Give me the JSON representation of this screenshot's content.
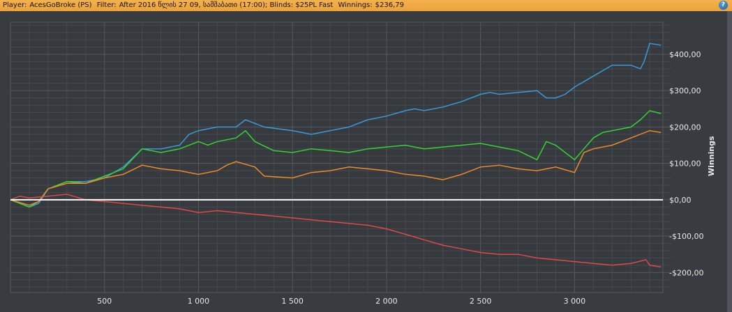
{
  "header": {
    "player_label": "Player:",
    "player": "AcesGoBroke (PS)",
    "filter_label": "Filter:",
    "filter": "After 2016 წლის 27 09, სამშაბათი (17:00); Blinds: $25PL Fast",
    "winnings_label": "Winnings:",
    "winnings": "$236,79",
    "help": "?"
  },
  "chart_data": {
    "type": "line",
    "title": "",
    "xlabel": "",
    "ylabel": "Winnings",
    "xlim": [
      0,
      3470
    ],
    "ylim": [
      -255,
      488
    ],
    "x_ticks": [
      500,
      1000,
      1500,
      2000,
      2500,
      3000
    ],
    "x_tick_labels": [
      "500",
      "1 000",
      "1 500",
      "2 000",
      "2 500",
      "3 000"
    ],
    "y_ticks": [
      400,
      300,
      200,
      100,
      0,
      -100,
      -200
    ],
    "y_tick_labels": [
      "$400,00",
      "$300,00",
      "$200,00",
      "$100,00",
      "$0,00",
      "-$100,00",
      "-$200,00"
    ],
    "grid": true,
    "series": [
      {
        "name": "blue",
        "color": "#3a9ad9",
        "points": [
          [
            0,
            0
          ],
          [
            100,
            -20
          ],
          [
            150,
            -10
          ],
          [
            200,
            30
          ],
          [
            300,
            50
          ],
          [
            400,
            50
          ],
          [
            500,
            60
          ],
          [
            600,
            90
          ],
          [
            700,
            140
          ],
          [
            800,
            140
          ],
          [
            900,
            150
          ],
          [
            950,
            180
          ],
          [
            1000,
            190
          ],
          [
            1100,
            200
          ],
          [
            1200,
            200
          ],
          [
            1250,
            220
          ],
          [
            1350,
            200
          ],
          [
            1500,
            190
          ],
          [
            1600,
            180
          ],
          [
            1700,
            190
          ],
          [
            1800,
            200
          ],
          [
            1900,
            220
          ],
          [
            2000,
            230
          ],
          [
            2100,
            245
          ],
          [
            2150,
            250
          ],
          [
            2200,
            245
          ],
          [
            2300,
            255
          ],
          [
            2400,
            270
          ],
          [
            2500,
            290
          ],
          [
            2550,
            295
          ],
          [
            2600,
            290
          ],
          [
            2700,
            295
          ],
          [
            2800,
            300
          ],
          [
            2850,
            280
          ],
          [
            2900,
            280
          ],
          [
            2950,
            290
          ],
          [
            3000,
            310
          ],
          [
            3100,
            340
          ],
          [
            3200,
            370
          ],
          [
            3300,
            370
          ],
          [
            3350,
            360
          ],
          [
            3370,
            380
          ],
          [
            3400,
            430
          ],
          [
            3460,
            425
          ]
        ]
      },
      {
        "name": "green",
        "color": "#33d433",
        "points": [
          [
            0,
            0
          ],
          [
            100,
            -20
          ],
          [
            150,
            -5
          ],
          [
            200,
            30
          ],
          [
            300,
            50
          ],
          [
            400,
            45
          ],
          [
            500,
            65
          ],
          [
            600,
            85
          ],
          [
            700,
            140
          ],
          [
            800,
            130
          ],
          [
            900,
            140
          ],
          [
            1000,
            160
          ],
          [
            1050,
            150
          ],
          [
            1100,
            160
          ],
          [
            1200,
            170
          ],
          [
            1250,
            190
          ],
          [
            1300,
            160
          ],
          [
            1400,
            135
          ],
          [
            1500,
            130
          ],
          [
            1600,
            140
          ],
          [
            1700,
            135
          ],
          [
            1800,
            130
          ],
          [
            1900,
            140
          ],
          [
            2000,
            145
          ],
          [
            2100,
            150
          ],
          [
            2200,
            140
          ],
          [
            2300,
            145
          ],
          [
            2400,
            150
          ],
          [
            2500,
            155
          ],
          [
            2600,
            145
          ],
          [
            2700,
            135
          ],
          [
            2800,
            110
          ],
          [
            2850,
            160
          ],
          [
            2900,
            150
          ],
          [
            3000,
            110
          ],
          [
            3050,
            140
          ],
          [
            3100,
            170
          ],
          [
            3150,
            185
          ],
          [
            3200,
            190
          ],
          [
            3300,
            200
          ],
          [
            3350,
            220
          ],
          [
            3400,
            245
          ],
          [
            3460,
            237
          ]
        ]
      },
      {
        "name": "orange",
        "color": "#ee8a2a",
        "points": [
          [
            0,
            0
          ],
          [
            100,
            -15
          ],
          [
            150,
            -5
          ],
          [
            200,
            30
          ],
          [
            300,
            45
          ],
          [
            400,
            45
          ],
          [
            500,
            60
          ],
          [
            600,
            70
          ],
          [
            700,
            95
          ],
          [
            800,
            85
          ],
          [
            900,
            80
          ],
          [
            1000,
            70
          ],
          [
            1100,
            80
          ],
          [
            1150,
            95
          ],
          [
            1200,
            105
          ],
          [
            1300,
            90
          ],
          [
            1350,
            65
          ],
          [
            1500,
            60
          ],
          [
            1600,
            75
          ],
          [
            1700,
            80
          ],
          [
            1800,
            90
          ],
          [
            1900,
            85
          ],
          [
            2000,
            80
          ],
          [
            2100,
            70
          ],
          [
            2200,
            65
          ],
          [
            2300,
            55
          ],
          [
            2400,
            70
          ],
          [
            2500,
            90
          ],
          [
            2600,
            95
          ],
          [
            2700,
            85
          ],
          [
            2800,
            80
          ],
          [
            2900,
            90
          ],
          [
            3000,
            75
          ],
          [
            3050,
            130
          ],
          [
            3100,
            140
          ],
          [
            3200,
            150
          ],
          [
            3300,
            170
          ],
          [
            3400,
            190
          ],
          [
            3460,
            185
          ]
        ]
      },
      {
        "name": "red",
        "color": "#e04848",
        "points": [
          [
            0,
            0
          ],
          [
            50,
            10
          ],
          [
            100,
            5
          ],
          [
            200,
            10
          ],
          [
            300,
            15
          ],
          [
            400,
            0
          ],
          [
            500,
            -5
          ],
          [
            600,
            -10
          ],
          [
            700,
            -15
          ],
          [
            800,
            -20
          ],
          [
            900,
            -25
          ],
          [
            1000,
            -35
          ],
          [
            1100,
            -30
          ],
          [
            1200,
            -35
          ],
          [
            1300,
            -40
          ],
          [
            1400,
            -45
          ],
          [
            1500,
            -50
          ],
          [
            1600,
            -55
          ],
          [
            1700,
            -60
          ],
          [
            1800,
            -65
          ],
          [
            1900,
            -70
          ],
          [
            2000,
            -80
          ],
          [
            2100,
            -95
          ],
          [
            2200,
            -110
          ],
          [
            2300,
            -125
          ],
          [
            2400,
            -135
          ],
          [
            2500,
            -145
          ],
          [
            2600,
            -150
          ],
          [
            2700,
            -150
          ],
          [
            2800,
            -160
          ],
          [
            2900,
            -165
          ],
          [
            3000,
            -170
          ],
          [
            3100,
            -175
          ],
          [
            3200,
            -180
          ],
          [
            3300,
            -175
          ],
          [
            3380,
            -165
          ],
          [
            3400,
            -180
          ],
          [
            3460,
            -185
          ]
        ]
      }
    ]
  }
}
